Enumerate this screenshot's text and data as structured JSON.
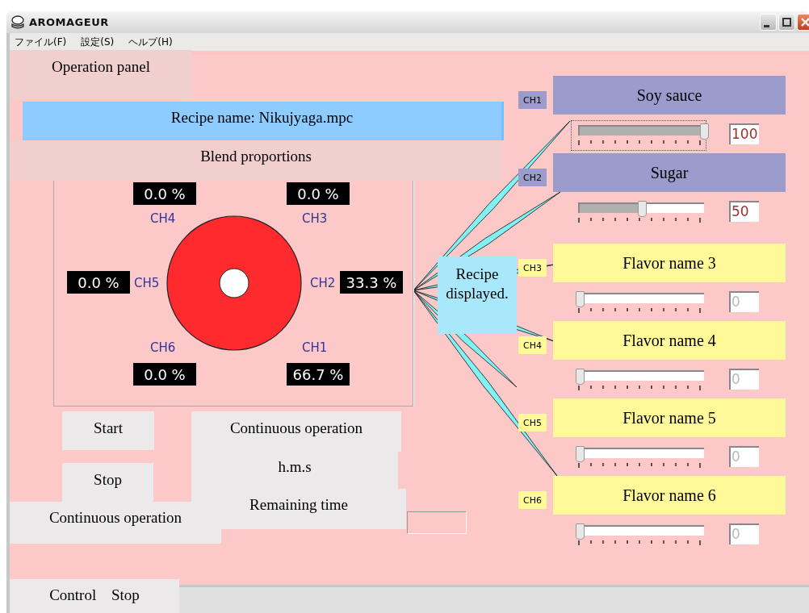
{
  "window": {
    "title": "AROMAGEUR"
  },
  "menu": [
    "ファイル(F)",
    "設定(S)",
    "ヘルプ(H)"
  ],
  "panel_title": "Operation panel",
  "recipe_name": "Recipe name: Nikujyaga.mpc",
  "blend": {
    "title": "Blend proportions",
    "slots": [
      {
        "label": "CH4",
        "reading": "0.0 %"
      },
      {
        "label": "CH3",
        "reading": "0.0 %"
      },
      {
        "label": "CH5",
        "reading": "0.0 %"
      },
      {
        "label": "CH2",
        "reading": "33.3 %"
      },
      {
        "label": "CH6",
        "reading": "0.0 %"
      },
      {
        "label": "CH1",
        "reading": "66.7 %"
      }
    ]
  },
  "status_message": "Recipe displayed.",
  "channels": [
    {
      "tag": "CH1",
      "name": "Soy sauce",
      "color": "#9b9bcc",
      "level": 1,
      "value": "100",
      "disabled": false,
      "focused": true
    },
    {
      "tag": "CH2",
      "name": "Sugar",
      "color": "#9b9bcc",
      "level": 0.5,
      "value": "50",
      "disabled": false,
      "focused": false
    },
    {
      "tag": "CH3",
      "name": "Flavor name 3",
      "color": "#fff99a",
      "level": 0,
      "value": "0",
      "disabled": true,
      "focused": false
    },
    {
      "tag": "CH4",
      "name": "Flavor name 4",
      "color": "#fff99a",
      "level": 0,
      "value": "0",
      "disabled": true,
      "focused": false
    },
    {
      "tag": "CH5",
      "name": "Flavor name 5",
      "color": "#fff99a",
      "level": 0,
      "value": "0",
      "disabled": true,
      "focused": false
    },
    {
      "tag": "CH6",
      "name": "Flavor name 6",
      "color": "#fff99a",
      "level": 0,
      "value": "0",
      "disabled": true,
      "focused": false
    }
  ],
  "start_button": "Start",
  "stop_button": "Stop",
  "continuous_button": "Continuous operation",
  "time_unit": "h.m.s",
  "remaining_label": "Remaining time",
  "continuous_label": "Continuous operation",
  "status_bar": "Control Stop"
}
